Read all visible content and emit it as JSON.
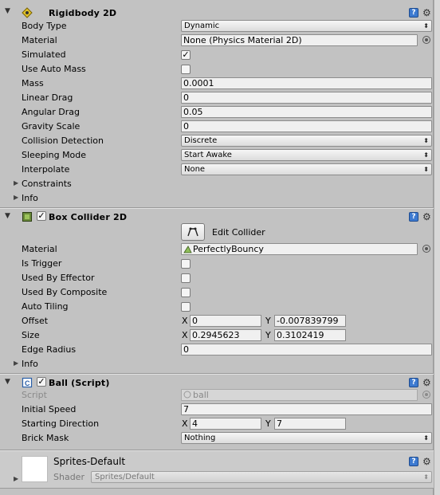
{
  "rigidbody": {
    "title": "Rigidbody 2D",
    "rows": [
      {
        "label": "Body Type",
        "value": "Dynamic"
      },
      {
        "label": "Material",
        "value": "None (Physics Material 2D)"
      },
      {
        "label": "Simulated",
        "value": "✓"
      },
      {
        "label": "Use Auto Mass",
        "value": ""
      },
      {
        "label": "Mass",
        "value": "0.0001"
      },
      {
        "label": "Linear Drag",
        "value": "0"
      },
      {
        "label": "Angular Drag",
        "value": "0.05"
      },
      {
        "label": "Gravity Scale",
        "value": "0"
      },
      {
        "label": "Collision Detection",
        "value": "Discrete"
      },
      {
        "label": "Sleeping Mode",
        "value": "Start Awake"
      },
      {
        "label": "Interpolate",
        "value": "None"
      },
      {
        "label": "Constraints",
        "value": ""
      },
      {
        "label": "Info",
        "value": ""
      }
    ]
  },
  "boxcollider": {
    "title": "Box Collider 2D",
    "edit_label": "Edit Collider",
    "rows": [
      {
        "label": "Material",
        "value": "PerfectlyBouncy"
      },
      {
        "label": "Is Trigger",
        "value": ""
      },
      {
        "label": "Used By Effector",
        "value": ""
      },
      {
        "label": "Used By Composite",
        "value": ""
      },
      {
        "label": "Auto Tiling",
        "value": ""
      },
      {
        "label": "Offset",
        "x_label": "X",
        "x": "0",
        "y_label": "Y",
        "y": "-0.007839799"
      },
      {
        "label": "Size",
        "x_label": "X",
        "x": "0.2945623",
        "y_label": "Y",
        "y": "0.3102419"
      },
      {
        "label": "Edge Radius",
        "value": "0"
      },
      {
        "label": "Info",
        "value": ""
      }
    ]
  },
  "ballscript": {
    "title": "Ball (Script)",
    "rows": [
      {
        "label": "Script",
        "value": "ball"
      },
      {
        "label": "Initial Speed",
        "value": "7"
      },
      {
        "label": "Starting Direction",
        "x_label": "X",
        "x": "4",
        "y_label": "Y",
        "y": "7"
      },
      {
        "label": "Brick Mask",
        "value": "Nothing"
      }
    ]
  },
  "material": {
    "title": "Sprites-Default",
    "shader_label": "Shader",
    "shader_value": "Sprites/Default"
  },
  "glyphs": {
    "fold_closed": "▶",
    "fold_open": "▼",
    "dropdown": "⬍",
    "gear": "⚙",
    "help": "?",
    "check": "✓"
  }
}
